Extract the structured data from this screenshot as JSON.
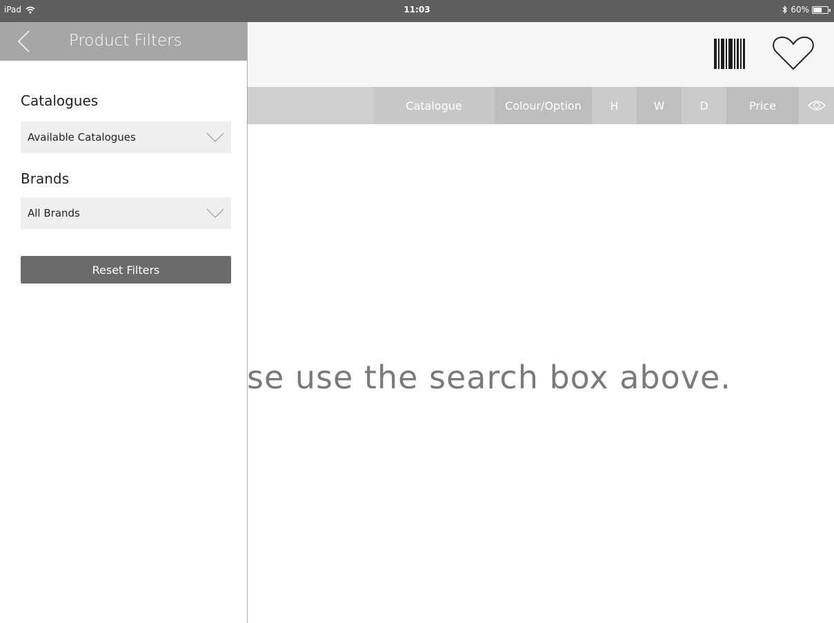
{
  "status": {
    "device": "iPad",
    "time": "11:03",
    "battery": "60%",
    "battery_level": 0.6
  },
  "header": {
    "icons": [
      "barcode-icon",
      "heart-icon"
    ]
  },
  "columns": {
    "catalogue": "Catalogue",
    "colour": "Colour/Option",
    "h": "H",
    "w": "W",
    "d": "D",
    "price": "Price"
  },
  "main": {
    "empty_message": "se use the search box above."
  },
  "drawer": {
    "title": "Product Filters",
    "catalogues_label": "Catalogues",
    "catalogues_value": "Available Catalogues",
    "brands_label": "Brands",
    "brands_value": "All Brands",
    "reset_label": "Reset Filters"
  }
}
